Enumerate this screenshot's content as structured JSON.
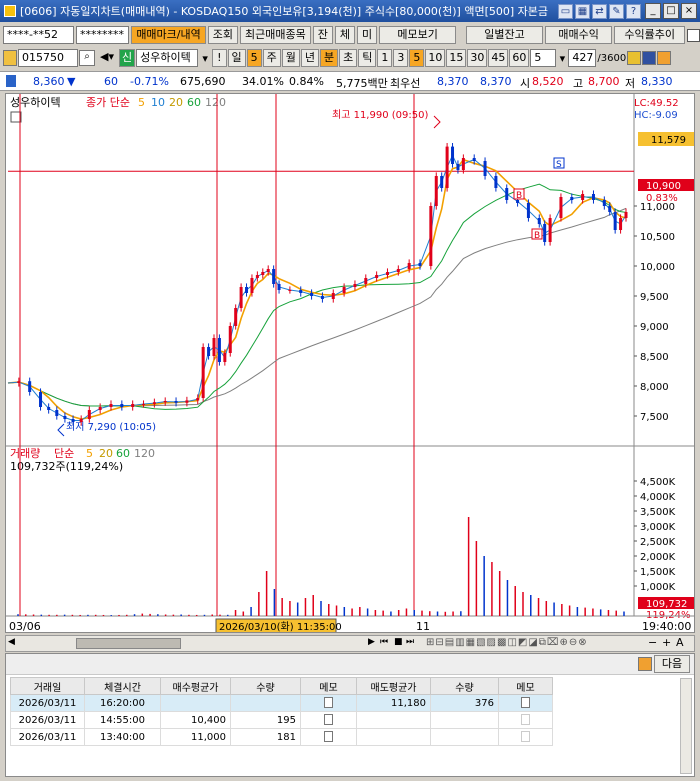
{
  "window": {
    "title": "[0606] 자동일지차트(매매내역) - KOSDAQ150 외국인보유[3,194(천)] 주식수[80,000(천)] 액면[500] 자본금"
  },
  "toolbar1": {
    "account": "****-**52",
    "password": "********",
    "btn_trade_mark": "매매마크/내역",
    "btn_query": "조회",
    "btn_recent": "최근매매종목",
    "btn_jan": "잔",
    "btn_che": "체",
    "btn_mi": "미",
    "btn_memo": "메모보기",
    "btn_daily": "일별잔고",
    "btn_profit": "매매수익",
    "btn_rate": "수익률추이"
  },
  "toolbar2": {
    "code": "015750",
    "stock_badge": "신",
    "stock_name": "성우하이텍",
    "excl": "!",
    "periods": [
      "일",
      "5",
      "주",
      "월",
      "년",
      "분",
      "초",
      "틱",
      "1",
      "3",
      "5",
      "10",
      "15",
      "30",
      "45",
      "60"
    ],
    "count_value": "5",
    "count_pos": "427",
    "count_total": "/3600"
  },
  "quote": {
    "price": "8,360",
    "change": "60",
    "rate": "-0.71%",
    "volume": "675,690",
    "vol_rate": "34.01%",
    "turnover": "0.84%",
    "amount": "5,775백만",
    "ask_label": "최우선",
    "ask": "8,370",
    "bid": "8,370",
    "open_label": "시",
    "open": "8,520",
    "high_label": "고",
    "high": "8,700",
    "low_label": "저",
    "low": "8,330"
  },
  "chart_data": [
    {
      "type": "line",
      "name": "price-panel",
      "title": "성우하이텍",
      "legend": {
        "prefix": "종가 단순",
        "periods": [
          "5",
          "10",
          "20",
          "60",
          "120"
        ]
      },
      "ylim": [
        7000,
        12200
      ],
      "yticks": [
        7500,
        8000,
        8500,
        9000,
        9500,
        10000,
        10500,
        11000
      ],
      "ytick_labels": [
        "7,500",
        "8,000",
        "8,500",
        "9,000",
        "9,500",
        "10,000",
        "10,500",
        "11,000"
      ],
      "right_labels": {
        "lc": "LC:49.52",
        "hc": "HC:-9.09",
        "level": "11,579",
        "current": "10,900",
        "current_rate": "0.83%"
      },
      "annotations": {
        "high": "최고 11,990 (09:50)",
        "low": "최저 7,290 (10:05)"
      },
      "series": [
        {
          "points": [
            [
              0,
              8050
            ],
            [
              4,
              8080
            ],
            [
              8,
              7900
            ],
            [
              12,
              7650
            ],
            [
              15,
              7600
            ],
            [
              18,
              7500
            ],
            [
              21,
              7450
            ],
            [
              24,
              7400
            ],
            [
              27,
              7450
            ],
            [
              30,
              7600
            ],
            [
              34,
              7650
            ],
            [
              38,
              7700
            ],
            [
              42,
              7650
            ],
            [
              46,
              7700
            ],
            [
              50,
              7700
            ],
            [
              54,
              7730
            ],
            [
              58,
              7750
            ],
            [
              62,
              7720
            ],
            [
              66,
              7760
            ],
            [
              70,
              7800
            ],
            [
              72,
              8650
            ],
            [
              74,
              8500
            ],
            [
              76,
              8800
            ],
            [
              78,
              8400
            ],
            [
              80,
              8550
            ],
            [
              82,
              9000
            ],
            [
              84,
              9300
            ],
            [
              86,
              9650
            ],
            [
              88,
              9550
            ],
            [
              90,
              9800
            ],
            [
              92,
              9850
            ],
            [
              94,
              9900
            ],
            [
              96,
              9950
            ],
            [
              98,
              9700
            ],
            [
              100,
              9600
            ],
            [
              104,
              9600
            ],
            [
              108,
              9550
            ],
            [
              112,
              9500
            ],
            [
              116,
              9450
            ],
            [
              120,
              9550
            ],
            [
              124,
              9650
            ],
            [
              128,
              9700
            ],
            [
              132,
              9800
            ],
            [
              136,
              9850
            ],
            [
              140,
              9900
            ],
            [
              144,
              9950
            ],
            [
              148,
              10050
            ],
            [
              152,
              10000
            ],
            [
              156,
              11000
            ],
            [
              158,
              11500
            ],
            [
              160,
              11300
            ],
            [
              162,
              11990
            ],
            [
              164,
              11700
            ],
            [
              166,
              11600
            ],
            [
              168,
              11800
            ],
            [
              172,
              11750
            ],
            [
              176,
              11500
            ],
            [
              180,
              11300
            ],
            [
              184,
              11100
            ],
            [
              188,
              11050
            ],
            [
              192,
              10800
            ],
            [
              196,
              10700
            ],
            [
              198,
              10400
            ],
            [
              200,
              10800
            ],
            [
              204,
              11150
            ],
            [
              208,
              11100
            ],
            [
              212,
              11200
            ],
            [
              216,
              11100
            ],
            [
              220,
              11000
            ],
            [
              222,
              10900
            ],
            [
              224,
              10600
            ],
            [
              226,
              10800
            ],
            [
              228,
              10900
            ]
          ]
        }
      ]
    },
    {
      "type": "bar",
      "name": "volume-panel",
      "title": "거래량",
      "legend": {
        "prefix": "단순",
        "periods": [
          "5",
          "20",
          "60",
          "120"
        ]
      },
      "info": "109,732주(119,24%)",
      "ylim": [
        0,
        5000
      ],
      "yticks": [
        1000,
        1500,
        2000,
        2500,
        3000,
        3500,
        4000,
        4500
      ],
      "ytick_labels": [
        "1,000K",
        "1,500K",
        "2,000K",
        "2,500K",
        "3,000K",
        "3,500K",
        "4,000K",
        "4,500K"
      ],
      "right_labels": {
        "current": "109,732",
        "rate": "119,24%"
      },
      "values": [
        60,
        55,
        50,
        45,
        40,
        40,
        45,
        40,
        35,
        40,
        40,
        35,
        30,
        35,
        40,
        60,
        80,
        70,
        60,
        50,
        45,
        50,
        40,
        35,
        40,
        50,
        45,
        40,
        200,
        150,
        300,
        800,
        1500,
        900,
        600,
        500,
        450,
        600,
        700,
        500,
        400,
        350,
        300,
        250,
        300,
        250,
        200,
        180,
        150,
        200,
        250,
        200,
        180,
        160,
        150,
        140,
        150,
        160,
        3300,
        2500,
        2000,
        1800,
        1500,
        1200,
        1000,
        800,
        700,
        600,
        500,
        450,
        400,
        350,
        300,
        280,
        250,
        220,
        200,
        180,
        150
      ]
    }
  ],
  "xaxis": {
    "labels": [
      "03/06",
      "11"
    ],
    "crosshair_label": "2026/03/10(화) 11:35:00",
    "time_label": "19:40:00"
  },
  "bottom": {
    "next_btn": "다음",
    "headers": [
      "거래일",
      "체결시간",
      "매수평균가",
      "수량",
      "메모",
      "매도평균가",
      "수량",
      "메모"
    ],
    "rows": [
      {
        "date": "2026/03/11",
        "time": "16:20:00",
        "buy_avg": "",
        "buy_qty": "",
        "sell_avg": "11,180",
        "sell_qty": "376"
      },
      {
        "date": "2026/03/11",
        "time": "14:55:00",
        "buy_avg": "10,400",
        "buy_qty": "195",
        "sell_avg": "",
        "sell_qty": ""
      },
      {
        "date": "2026/03/11",
        "time": "13:40:00",
        "buy_avg": "11,000",
        "buy_qty": "181",
        "sell_avg": "",
        "sell_qty": ""
      }
    ]
  },
  "colors": {
    "up": "#e0001a",
    "down": "#0033cc",
    "ma5": "#f2a000",
    "ma10": "#1f7fd1",
    "ma20": "#c39a00",
    "ma60": "#17a23b",
    "ma120": "#808080"
  }
}
